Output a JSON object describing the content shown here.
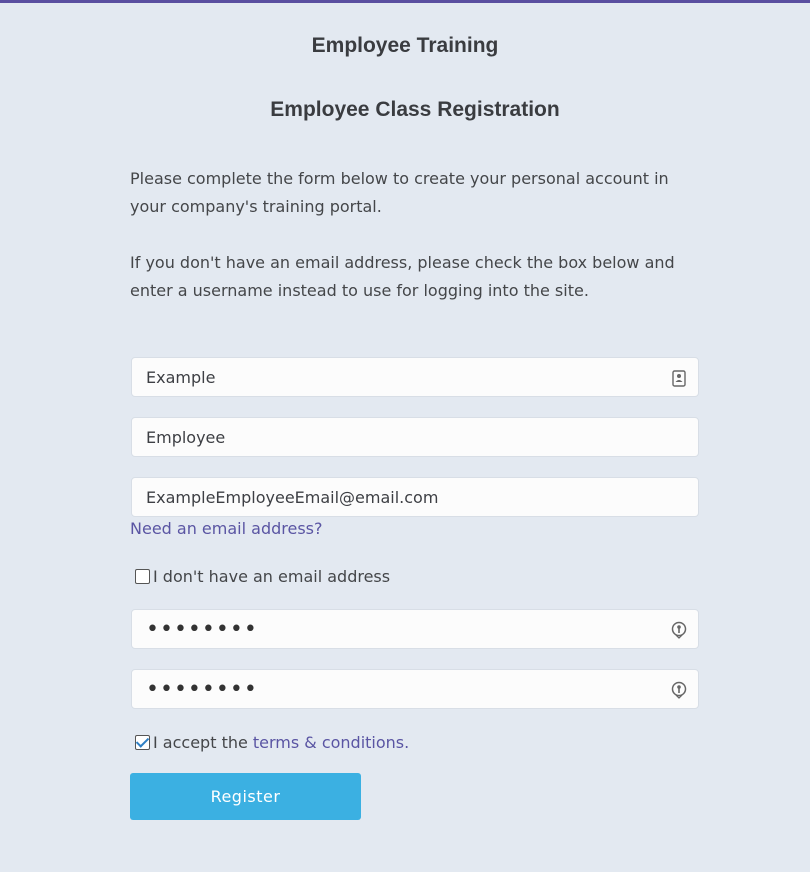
{
  "header": {
    "site_title": "Employee Training",
    "page_title": "Employee Class Registration"
  },
  "intro": {
    "paragraph1": "Please complete the form below to create your personal account in your company's training portal.",
    "paragraph2": "If you don't have an email address, please check the box below and enter a username instead to use for logging into the site."
  },
  "form": {
    "first_name": {
      "value": "Example",
      "icon": "contact-card-icon"
    },
    "last_name": {
      "value": "Employee"
    },
    "email": {
      "value": "ExampleEmployeeEmail@email.com"
    },
    "need_email_link": "Need an email address?",
    "no_email_checkbox": {
      "label": "I don't have an email address",
      "checked": false
    },
    "password": {
      "value": "••••••••",
      "icon": "password-key-icon"
    },
    "confirm_password": {
      "value": "••••••••",
      "icon": "password-key-icon"
    },
    "terms_checkbox": {
      "label": "I accept the",
      "link": "terms & conditions.",
      "checked": true
    },
    "register_label": "Register"
  },
  "colors": {
    "background": "#e3e9f1",
    "accent_bar": "#5a4fa0",
    "link": "#5a55a3",
    "button": "#3bb0e2",
    "checkmark": "#2f7fc4"
  }
}
